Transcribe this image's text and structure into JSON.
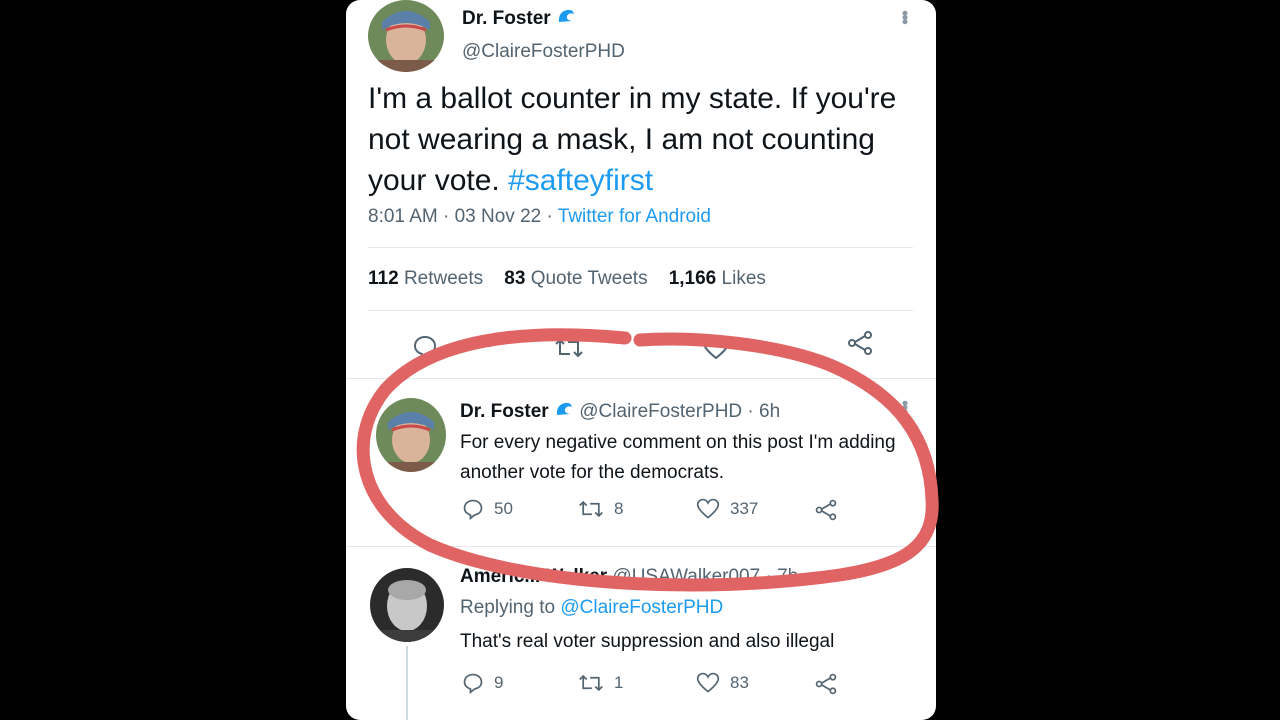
{
  "main_tweet": {
    "display_name": "Dr. Foster",
    "badge_icon": "wave-icon",
    "handle": "@ClaireFosterPHD",
    "text_body": "I'm a ballot counter in my state. If you're not wearing a mask, I am not counting your vote.",
    "hashtag": "#safteyfirst",
    "time": "8:01 AM",
    "date": "03 Nov 22",
    "sep": "·",
    "source": "Twitter for Android",
    "stats": {
      "retweets_count": "112",
      "retweets_label": "Retweets",
      "quotes_count": "83",
      "quotes_label": "Quote Tweets",
      "likes_count": "1,166",
      "likes_label": "Likes"
    }
  },
  "reply_tweet": {
    "display_name": "Dr. Foster",
    "handle": "@ClaireFosterPHD",
    "age": "· 6h",
    "text": "For every negative comment on this post I'm adding another vote for the democrats.",
    "replies": "50",
    "retweets": "8",
    "likes": "337"
  },
  "third_tweet": {
    "display_name": "Americ... Walker",
    "handle": "@USAWalker007 · 7h",
    "replying_to_label": "Replying to",
    "replying_to_handle": "@ClaireFosterPHD",
    "text": "That's real voter suppression and also illegal",
    "replies": "9",
    "retweets": "1",
    "likes": "83"
  },
  "colors": {
    "annotation_red": "#e06464",
    "link_blue": "#1d9bf0"
  }
}
